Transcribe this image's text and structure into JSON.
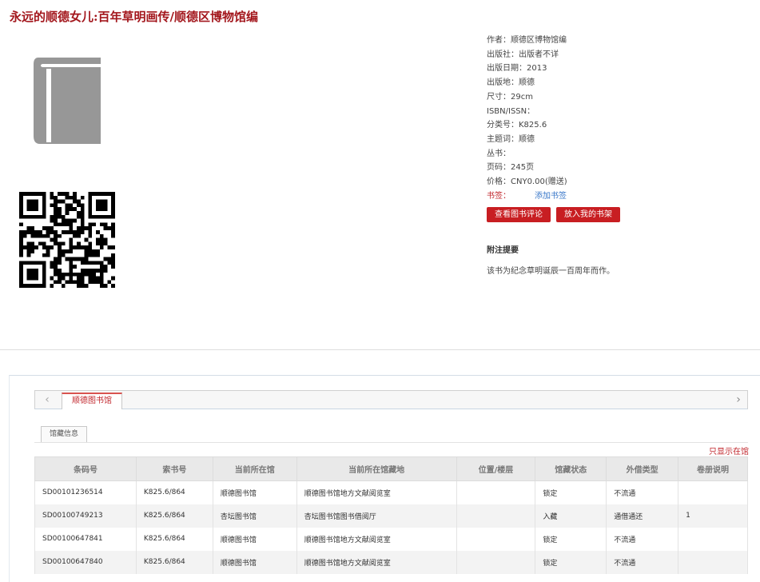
{
  "title": "永远的顺德女儿:百年草明画传/顺德区博物馆编",
  "icons": {
    "cover": "book-icon",
    "qr": "qr-code",
    "prev": "chevron-left-icon",
    "next": "chevron-right-icon"
  },
  "meta": [
    "作者：顺德区博物馆编",
    "出版社：出版者不详",
    "出版日期：2013",
    "出版地：顺德",
    "尺寸：29cm",
    "ISBN/ISSN：",
    "分类号：K825.6",
    "主题词：顺德",
    "丛书：",
    "页码：245页",
    "价格：CNY0.00(赠送)"
  ],
  "tags": {
    "label": "书签：",
    "add_link": "添加书签"
  },
  "buttons": {
    "view_review": "查看图书评论",
    "add_shelf": "放入我的书架"
  },
  "abstract": {
    "title": "附注提要",
    "text": "该书为纪念草明诞辰一百周年而作。"
  },
  "holdings": {
    "tab_library": "顺德图书馆",
    "subtab": "馆藏信息",
    "filter_link": "只显示在馆",
    "columns": [
      "条码号",
      "索书号",
      "当前所在馆",
      "当前所在馆藏地",
      "位置/楼层",
      "馆藏状态",
      "外借类型",
      "卷册说明"
    ],
    "rows": [
      [
        "SD00101236514",
        "K825.6/864",
        "顺德图书馆",
        "顺德图书馆地方文献阅览室",
        "",
        "锁定",
        "不流通",
        ""
      ],
      [
        "SD00100749213",
        "K825.6/864",
        "杏坛图书馆",
        "杏坛图书馆图书借阅厅",
        "",
        "入藏",
        "通借通还",
        "1"
      ],
      [
        "SD00100647841",
        "K825.6/864",
        "顺德图书馆",
        "顺德图书馆地方文献阅览室",
        "",
        "锁定",
        "不流通",
        ""
      ],
      [
        "SD00100647840",
        "K825.6/864",
        "顺德图书馆",
        "顺德图书馆地方文献阅览室",
        "",
        "锁定",
        "不流通",
        ""
      ]
    ]
  }
}
